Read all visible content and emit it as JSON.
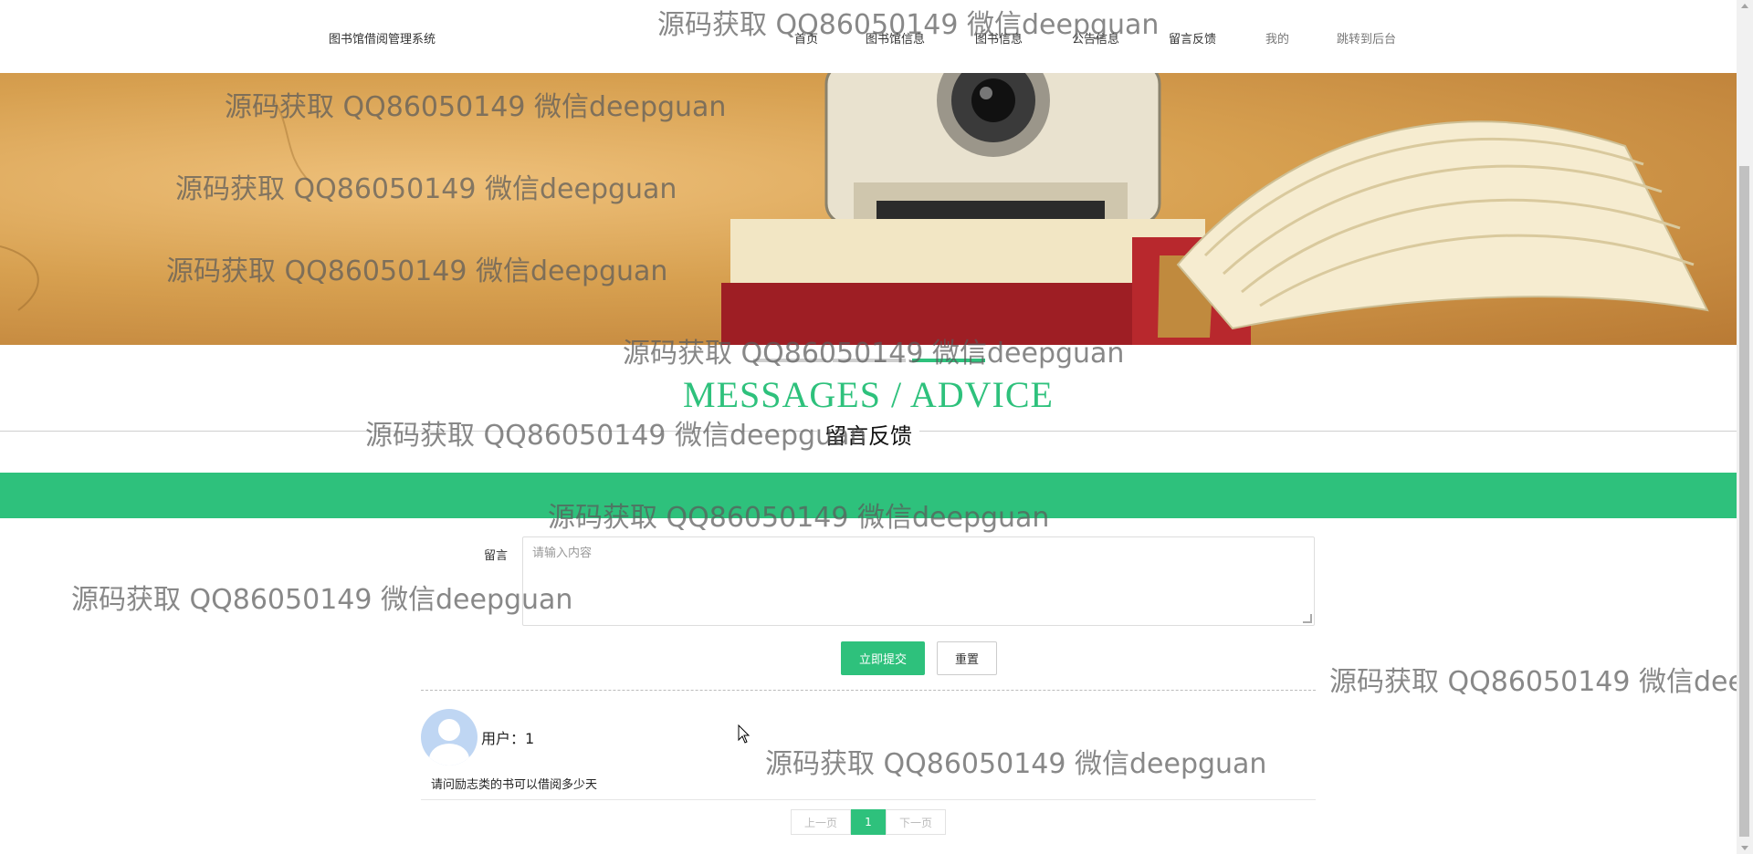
{
  "nav": {
    "brand": "图书馆借阅管理系统",
    "items": [
      "首页",
      "图书馆信息",
      "图书信息",
      "公告信息",
      "留言反馈",
      "我的",
      "跳转到后台"
    ]
  },
  "section": {
    "title_en": "MESSAGES / ADVICE",
    "title_cn": "留言反馈"
  },
  "form": {
    "label": "留言",
    "placeholder": "请输入内容",
    "submit_label": "立即提交",
    "reset_label": "重置"
  },
  "messages": [
    {
      "user_label": "用户：",
      "user": "1",
      "content": "请问励志类的书可以借阅多少天"
    }
  ],
  "pagination": {
    "prev": "上一页",
    "current": "1",
    "next": "下一页"
  },
  "watermark": "源码获取 QQ86050149 微信deepguan",
  "colors": {
    "accent": "#2ec17c",
    "avatar": "#bfd6f3"
  },
  "icons": {
    "cursor": "mouse-pointer-icon",
    "avatar": "user-avatar-icon"
  }
}
